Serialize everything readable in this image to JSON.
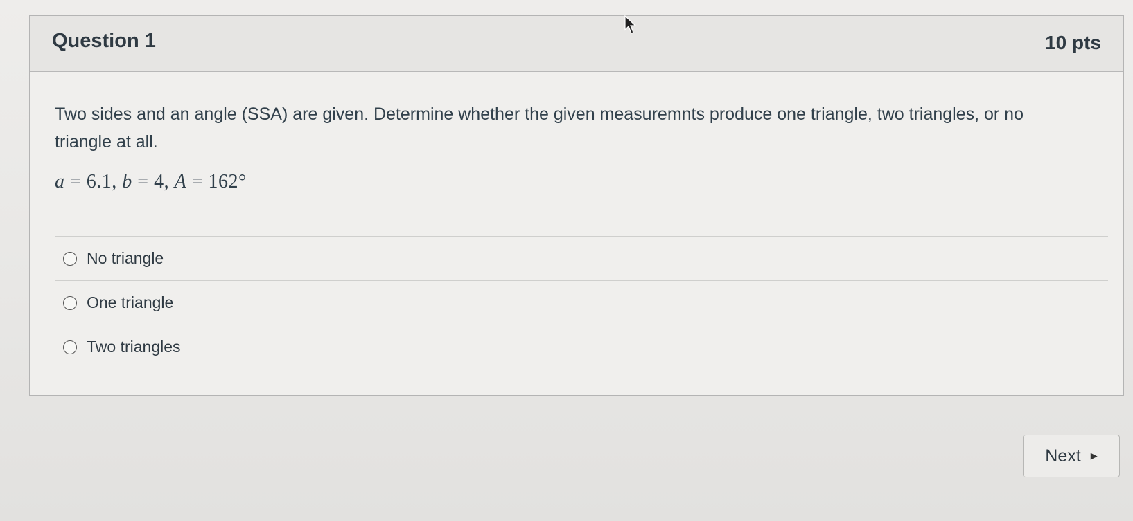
{
  "question": {
    "title": "Question 1",
    "points": "10 pts",
    "text": "Two sides and an angle (SSA) are given. Determine whether the given measuremnts produce one triangle, two triangles, or no triangle at all.",
    "given": {
      "a_var": "a",
      "a_value": "6.1",
      "b_var": "b",
      "b_value": "4",
      "A_var": "A",
      "A_value": "162°"
    },
    "answers": [
      {
        "label": "No triangle",
        "selected": false
      },
      {
        "label": "One triangle",
        "selected": false
      },
      {
        "label": "Two triangles",
        "selected": false
      }
    ]
  },
  "navigation": {
    "next_label": "Next",
    "next_icon": "caret-right-icon"
  }
}
